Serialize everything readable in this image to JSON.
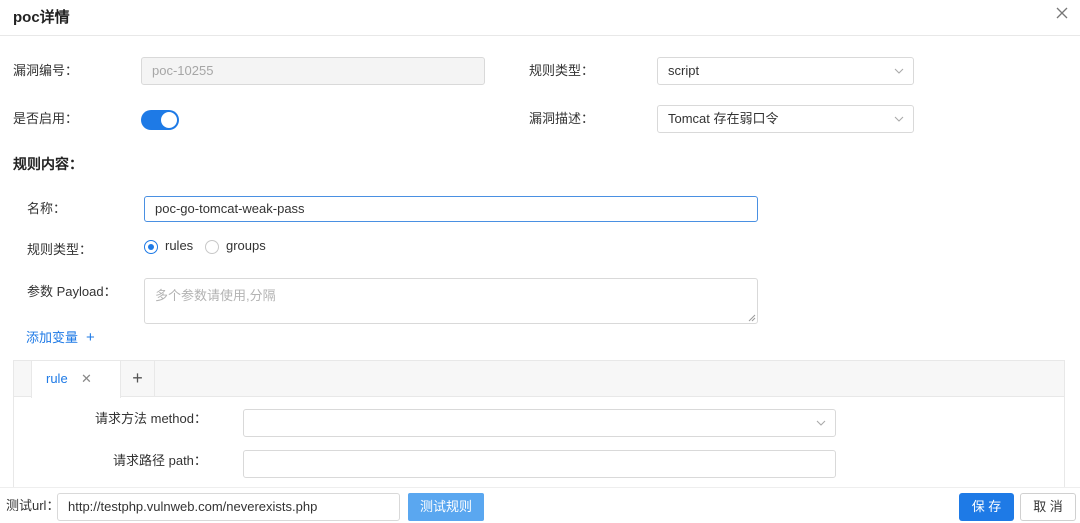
{
  "modal": {
    "title": "poc详情"
  },
  "form": {
    "vuln_id": {
      "label": "漏洞编号：",
      "value": "poc-10255"
    },
    "rule_type_top": {
      "label": "规则类型：",
      "value": "script"
    },
    "enabled": {
      "label": "是否启用：",
      "on": true
    },
    "vuln_desc": {
      "label": "漏洞描述：",
      "value": "Tomcat 存在弱口令"
    }
  },
  "rule_content": {
    "title": "规则内容：",
    "name": {
      "label": "名称：",
      "value": "poc-go-tomcat-weak-pass"
    },
    "rule_type": {
      "label": "规则类型：",
      "options": [
        "rules",
        "groups"
      ],
      "selected": "rules"
    },
    "payload": {
      "label": "参数 Payload：",
      "placeholder": "多个参数请使用,分隔"
    },
    "add_variable": {
      "label": "添加变量",
      "icon": "plus-icon"
    }
  },
  "tabs": {
    "items": [
      {
        "label": "rule",
        "active": true
      }
    ],
    "add_icon": "plus-icon"
  },
  "rule_tab": {
    "method": {
      "label": "请求方法 method：",
      "value": ""
    },
    "path": {
      "label": "请求路径 path：",
      "value": ""
    }
  },
  "footer": {
    "test_url_label": "测试url：",
    "test_url_value": "http://testphp.vulnweb.com/neverexists.php",
    "test_button": "测试规则",
    "save_button": "保 存",
    "cancel_button": "取 消"
  },
  "colors": {
    "primary": "#1e7ae6",
    "test_button": "#5aa7f0"
  }
}
